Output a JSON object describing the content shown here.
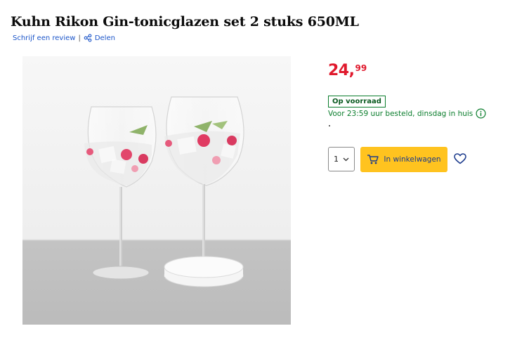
{
  "product": {
    "title": "Kuhn Rikon Gin-tonicglazen set 2 stuks 650ML"
  },
  "meta": {
    "review_link": "Schrijf een review",
    "separator": "|",
    "share_link": "Delen"
  },
  "icons": {
    "share": "share-icon",
    "info": "info-icon",
    "chevron": "chevron-down-icon",
    "cart": "cart-icon",
    "wishlist": "heart-icon"
  },
  "pricing": {
    "euros": "24,",
    "cents": "99"
  },
  "availability": {
    "badge": "Op voorraad",
    "delivery_text": "Voor 23:59 uur besteld, dinsdag in huis"
  },
  "purchase": {
    "quantity": "1",
    "cart_label": "In winkelwagen"
  },
  "colors": {
    "price": "#e0192d",
    "stock_green": "#0a7d2c",
    "cart_yellow": "#ffc31f",
    "link_blue": "#1a54c9",
    "cart_text_blue": "#1b3a8c"
  }
}
